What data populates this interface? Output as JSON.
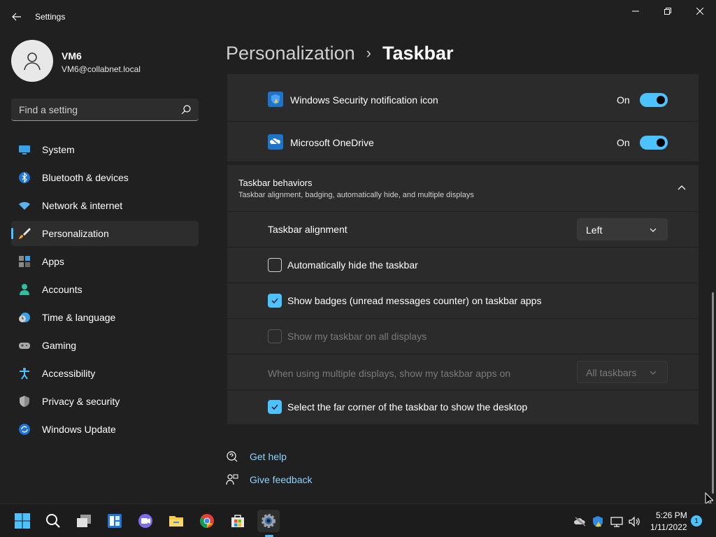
{
  "window": {
    "title": "Settings",
    "controls": [
      "minimize-icon",
      "restore-icon",
      "close-icon"
    ]
  },
  "user": {
    "name": "VM6",
    "email": "VM6@collabnet.local"
  },
  "search": {
    "placeholder": "Find a setting",
    "icon": "search-icon"
  },
  "sidebar": {
    "items": [
      {
        "label": "System",
        "icon": "monitor-icon"
      },
      {
        "label": "Bluetooth & devices",
        "icon": "bluetooth-icon"
      },
      {
        "label": "Network & internet",
        "icon": "wifi-icon"
      },
      {
        "label": "Personalization",
        "icon": "brush-icon",
        "active": true
      },
      {
        "label": "Apps",
        "icon": "apps-icon"
      },
      {
        "label": "Accounts",
        "icon": "person-icon"
      },
      {
        "label": "Time & language",
        "icon": "clock-globe-icon"
      },
      {
        "label": "Gaming",
        "icon": "gamepad-icon"
      },
      {
        "label": "Accessibility",
        "icon": "accessibility-icon"
      },
      {
        "label": "Privacy & security",
        "icon": "shield-icon"
      },
      {
        "label": "Windows Update",
        "icon": "update-icon"
      }
    ]
  },
  "breadcrumb": {
    "parent": "Personalization",
    "separator": "›",
    "current": "Taskbar"
  },
  "overflow_icons": [
    {
      "label": "Windows Security notification icon",
      "state": "On",
      "icon": "windows-security-icon"
    },
    {
      "label": "Microsoft OneDrive",
      "state": "On",
      "icon": "onedrive-icon"
    }
  ],
  "behaviors": {
    "title": "Taskbar behaviors",
    "subtitle": "Taskbar alignment, badging, automatically hide, and multiple displays",
    "alignment_label": "Taskbar alignment",
    "alignment_value": "Left",
    "auto_hide_label": "Automatically hide the taskbar",
    "auto_hide_checked": false,
    "badges_label": "Show badges (unread messages counter) on taskbar apps",
    "badges_checked": true,
    "all_displays_label": "Show my taskbar on all displays",
    "all_displays_checked": false,
    "multi_display_label": "When using multiple displays, show my taskbar apps on",
    "multi_display_value": "All taskbars",
    "far_corner_label": "Select the far corner of the taskbar to show the desktop",
    "far_corner_checked": true
  },
  "links": {
    "help": "Get help",
    "feedback": "Give feedback"
  },
  "taskbar": {
    "apps": [
      "start-icon",
      "search-icon",
      "task-view-icon",
      "widgets-icon",
      "chat-icon",
      "file-explorer-icon",
      "chrome-icon",
      "store-icon",
      "settings-icon"
    ],
    "tray": [
      "onedrive-offline-icon",
      "security-icon",
      "network-icon",
      "volume-icon"
    ],
    "time": "5:26 PM",
    "date": "1/11/2022",
    "notifications": "1"
  },
  "colors": {
    "accent": "#4cc2ff",
    "background": "#202020",
    "card": "#2b2b2b"
  }
}
